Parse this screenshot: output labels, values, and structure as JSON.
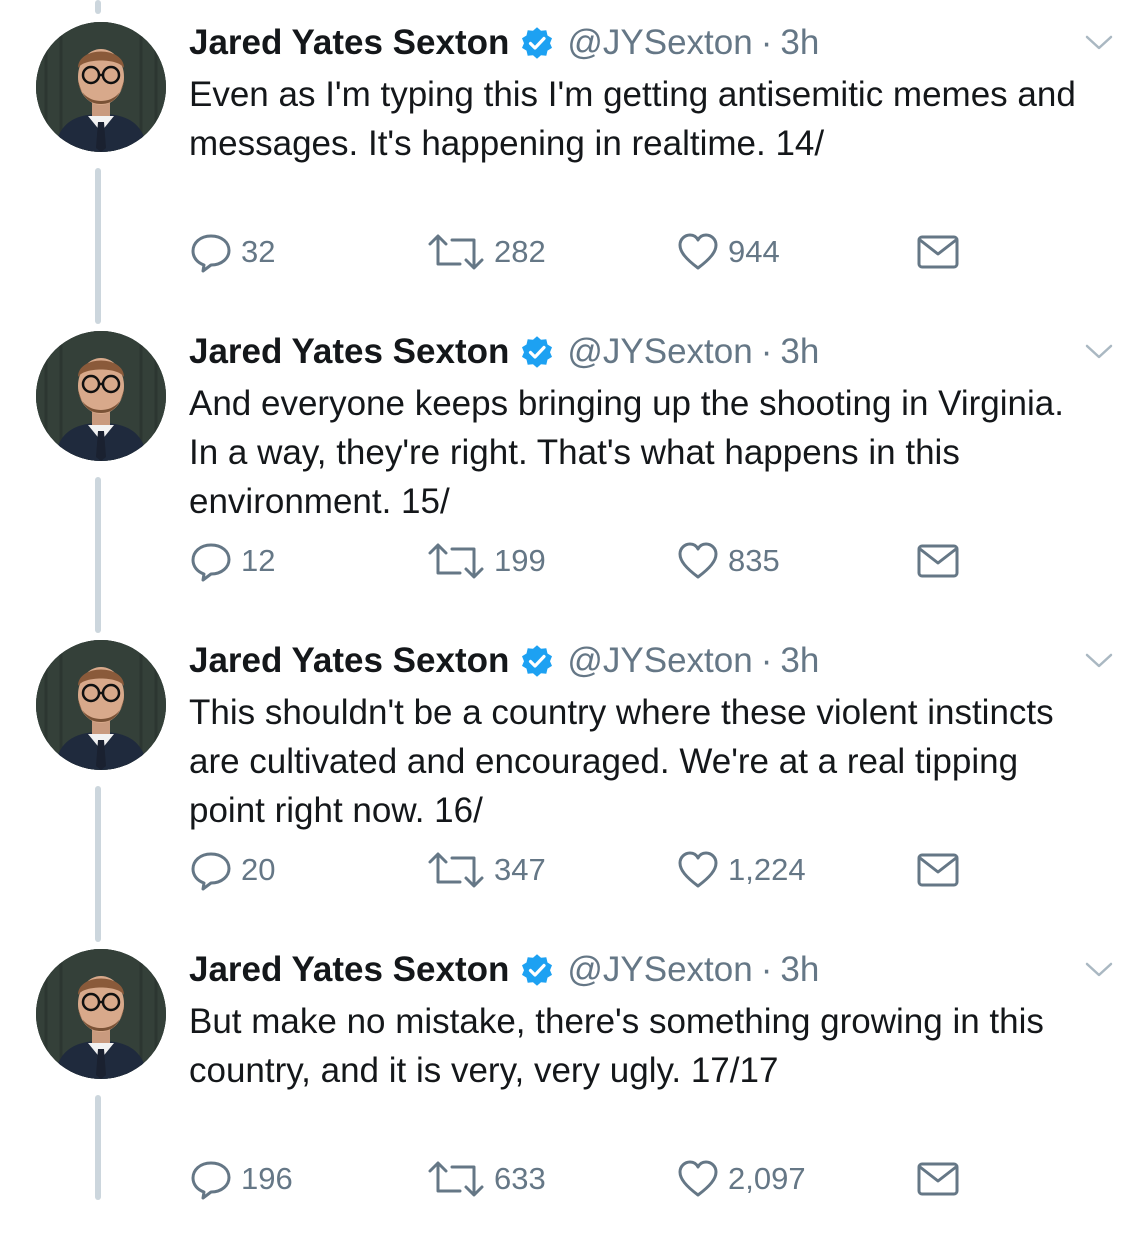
{
  "colors": {
    "text": "#14171a",
    "secondary": "#657786",
    "verified": "#1da1f2",
    "thread_line": "#ccd6dd"
  },
  "icons": {
    "reply": "speech-bubble",
    "retweet": "retweet-arrows",
    "like": "heart-outline",
    "dm": "envelope",
    "verified": "verified-badge",
    "more": "chevron-down"
  },
  "tweets": [
    {
      "name": "Jared Yates Sexton",
      "handle": "@JYSexton",
      "separator": "·",
      "time": "3h",
      "text": "Even as I'm typing this I'm getting antisemitic memes and messages. It's happening in realtime. 14/",
      "replies": "32",
      "retweets": "282",
      "likes": "944"
    },
    {
      "name": "Jared Yates Sexton",
      "handle": "@JYSexton",
      "separator": "·",
      "time": "3h",
      "text": "And everyone keeps bringing up the shooting in Virginia. In a way, they're right. That's what happens in this environment. 15/",
      "replies": "12",
      "retweets": "199",
      "likes": "835"
    },
    {
      "name": "Jared Yates Sexton",
      "handle": "@JYSexton",
      "separator": "·",
      "time": "3h",
      "text": "This shouldn't be a country where these violent instincts are cultivated and encouraged. We're at a real tipping point right now. 16/",
      "replies": "20",
      "retweets": "347",
      "likes": "1,224"
    },
    {
      "name": "Jared Yates Sexton",
      "handle": "@JYSexton",
      "separator": "·",
      "time": "3h",
      "text": "But make no mistake, there's something growing in this country, and it is very, very ugly. 17/17",
      "replies": "196",
      "retweets": "633",
      "likes": "2,097"
    }
  ]
}
